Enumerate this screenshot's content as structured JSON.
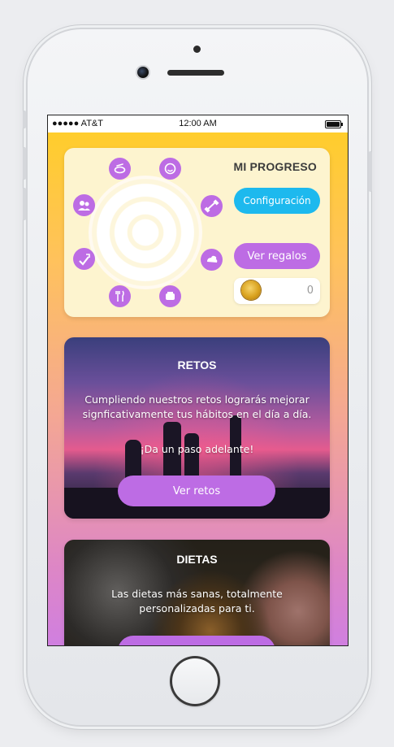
{
  "status_bar": {
    "carrier": "●●●●● AT&T",
    "time": "12:00 AM"
  },
  "progress": {
    "title": "MI PROGRESO",
    "config_button": "Configuración",
    "gifts_button": "Ver regalos",
    "coin_count": "0",
    "habit_icons": [
      "nutrition-icon",
      "mood-icon",
      "exercise-icon",
      "sleep-icon",
      "food-icon",
      "recycling-icon",
      "hydration-icon",
      "social-icon"
    ]
  },
  "retos": {
    "title": "RETOS",
    "description": "Cumpliendo nuestros retos lograrás mejorar signficativamente tus hábitos en el día a día.",
    "tagline": "¡Da un paso adelante!",
    "button": "Ver retos"
  },
  "dietas": {
    "title": "DIETAS",
    "description": "Las dietas más sanas, totalmente personalizadas para ti."
  },
  "colors": {
    "accent_purple": "#bd6ce4",
    "accent_blue": "#1db9ee",
    "background_top": "#ffcd2c",
    "background_bottom": "#d07fe0"
  }
}
